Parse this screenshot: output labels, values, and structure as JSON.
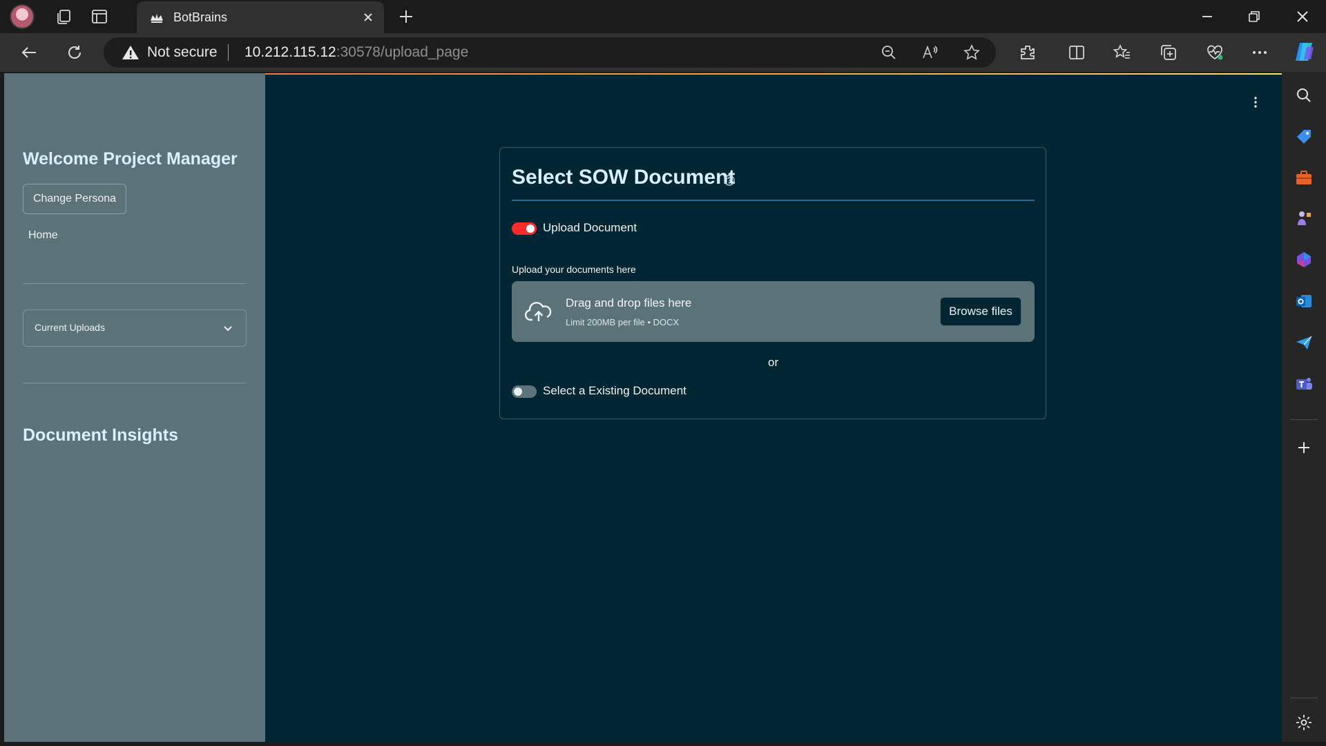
{
  "browser": {
    "tab_title": "BotBrains",
    "security_label": "Not secure",
    "url_host": "10.212.115.12",
    "url_rest": ":30578/upload_page"
  },
  "sidebar": {
    "welcome_title": "Welcome Project Manager",
    "change_persona_label": "Change Persona",
    "home_label": "Home",
    "expander_label": "Current Uploads",
    "insights_title": "Document Insights"
  },
  "main": {
    "card_title": "Select SOW Document",
    "upload_toggle_label": "Upload Document",
    "upload_toggle_on": true,
    "upload_caption": "Upload your documents here",
    "dropzone_main": "Drag and drop files here",
    "dropzone_sub": "Limit 200MB per file • DOCX",
    "browse_label": "Browse files",
    "or_text": "or",
    "existing_toggle_label": "Select a Existing Document",
    "existing_toggle_on": false
  },
  "colors": {
    "app_bg": "#002633",
    "sidebar_bg": "#5a7278",
    "toggle_on": "#ff2b2b",
    "heading": "#d9f0ff"
  }
}
